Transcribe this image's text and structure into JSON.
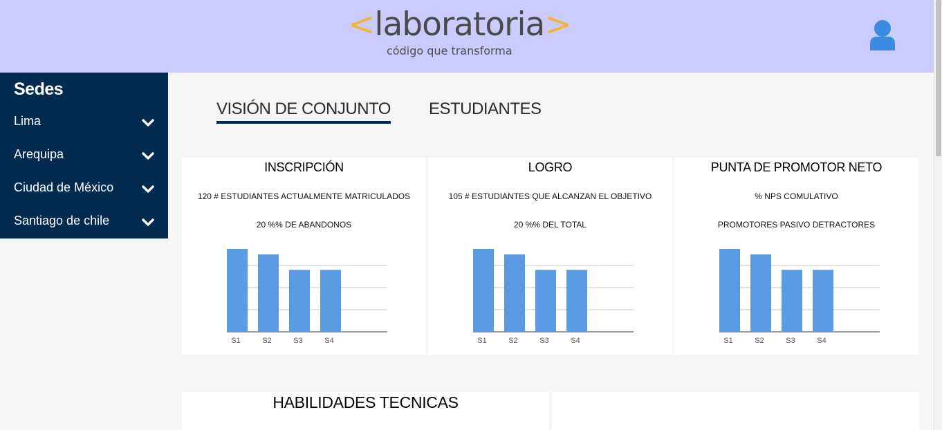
{
  "header": {
    "logo": {
      "bracket_left": "<",
      "word": "laboratoria",
      "bracket_right": ">",
      "tagline": "código que transforma",
      "accent_color": "#f0b53a"
    },
    "user_icon": "user-icon",
    "background": "#cbcbfd"
  },
  "sidebar": {
    "title": "Sedes",
    "background": "#022b4f",
    "items": [
      {
        "label": "Lima",
        "icon": "chevron-down-icon"
      },
      {
        "label": "Arequipa",
        "icon": "chevron-down-icon"
      },
      {
        "label": "Ciudad de México",
        "icon": "chevron-down-icon"
      },
      {
        "label": "Santiago de chile",
        "icon": "chevron-down-icon"
      }
    ]
  },
  "tabs": [
    {
      "label": "VISIÓN DE CONJUNTO",
      "active": true
    },
    {
      "label": "ESTUDIANTES",
      "active": false
    }
  ],
  "cards": [
    {
      "title": "INSCRIPCIÓN",
      "line1": "120 # ESTUDIANTES ACTUALMENTE MATRICULADOS",
      "line2": "20 %% DE ABANDONOS"
    },
    {
      "title": "LOGRO",
      "line1": "105 # ESTUDIANTES QUE ALCANZAN EL OBJETIVO",
      "line2": "20 %% DEL TOTAL"
    },
    {
      "title": "PUNTA DE PROMOTOR NETO",
      "line1": "% NPS COMULATIVO",
      "line2": "PROMOTORES PASIVO DETRACTORES"
    }
  ],
  "bottom_cards": [
    {
      "title": "HABILIDADES TECNICAS"
    },
    {
      "title": ""
    }
  ],
  "chart_data": [
    {
      "type": "bar",
      "categories": [
        "S1",
        "S2",
        "S3",
        "S4"
      ],
      "values": [
        37.5,
        35,
        28,
        28
      ],
      "ylim": [
        0,
        40
      ],
      "grid": true,
      "bar_color": "#5a9ae3"
    },
    {
      "type": "bar",
      "categories": [
        "S1",
        "S2",
        "S3",
        "S4"
      ],
      "values": [
        37.5,
        35,
        28,
        28
      ],
      "ylim": [
        0,
        40
      ],
      "grid": true,
      "bar_color": "#5a9ae3"
    },
    {
      "type": "bar",
      "categories": [
        "S1",
        "S2",
        "S3",
        "S4"
      ],
      "values": [
        37.5,
        35,
        28,
        28
      ],
      "ylim": [
        0,
        40
      ],
      "grid": true,
      "bar_color": "#5a9ae3"
    }
  ]
}
